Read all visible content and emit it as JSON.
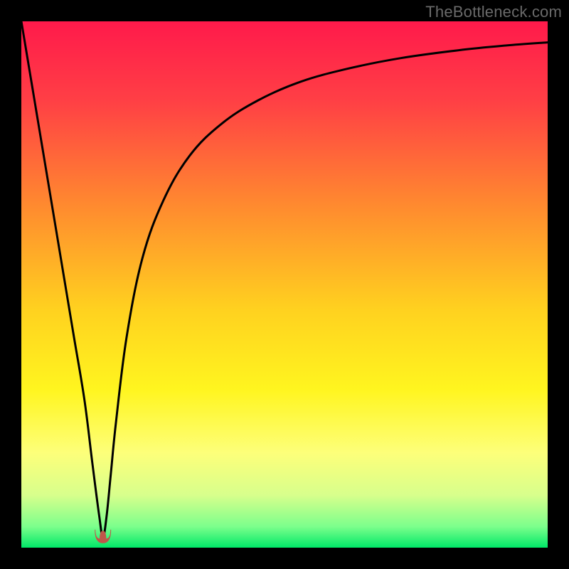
{
  "watermark": "TheBottleneck.com",
  "chart_data": {
    "type": "line",
    "title": "",
    "xlabel": "",
    "ylabel": "",
    "xlim": [
      0,
      100
    ],
    "ylim": [
      0,
      100
    ],
    "grid": false,
    "legend": false,
    "background_gradient": {
      "stops": [
        {
          "offset": 0.0,
          "color": "#ff1a4b"
        },
        {
          "offset": 0.15,
          "color": "#ff3f45"
        },
        {
          "offset": 0.35,
          "color": "#ff8a2f"
        },
        {
          "offset": 0.55,
          "color": "#ffd21f"
        },
        {
          "offset": 0.7,
          "color": "#fff51f"
        },
        {
          "offset": 0.82,
          "color": "#fdff7a"
        },
        {
          "offset": 0.9,
          "color": "#d8ff8c"
        },
        {
          "offset": 0.96,
          "color": "#7cff8c"
        },
        {
          "offset": 1.0,
          "color": "#00e868"
        }
      ]
    },
    "series": [
      {
        "name": "bottleneck-curve",
        "x": [
          0,
          2,
          4,
          6,
          8,
          10,
          12,
          13.5,
          14.8,
          15.5,
          16.2,
          17,
          18,
          20,
          23,
          27,
          32,
          38,
          45,
          53,
          62,
          72,
          83,
          92,
          100
        ],
        "y": [
          100,
          88,
          76,
          64,
          52,
          40,
          28,
          16,
          6,
          2,
          6,
          14,
          24,
          40,
          55,
          66,
          74.5,
          80.5,
          85,
          88.5,
          91,
          93,
          94.5,
          95.4,
          96
        ]
      }
    ],
    "marker": {
      "name": "optimal-point",
      "x": 15.5,
      "y": 1.5,
      "color": "#c0564a",
      "shape": "u"
    }
  }
}
